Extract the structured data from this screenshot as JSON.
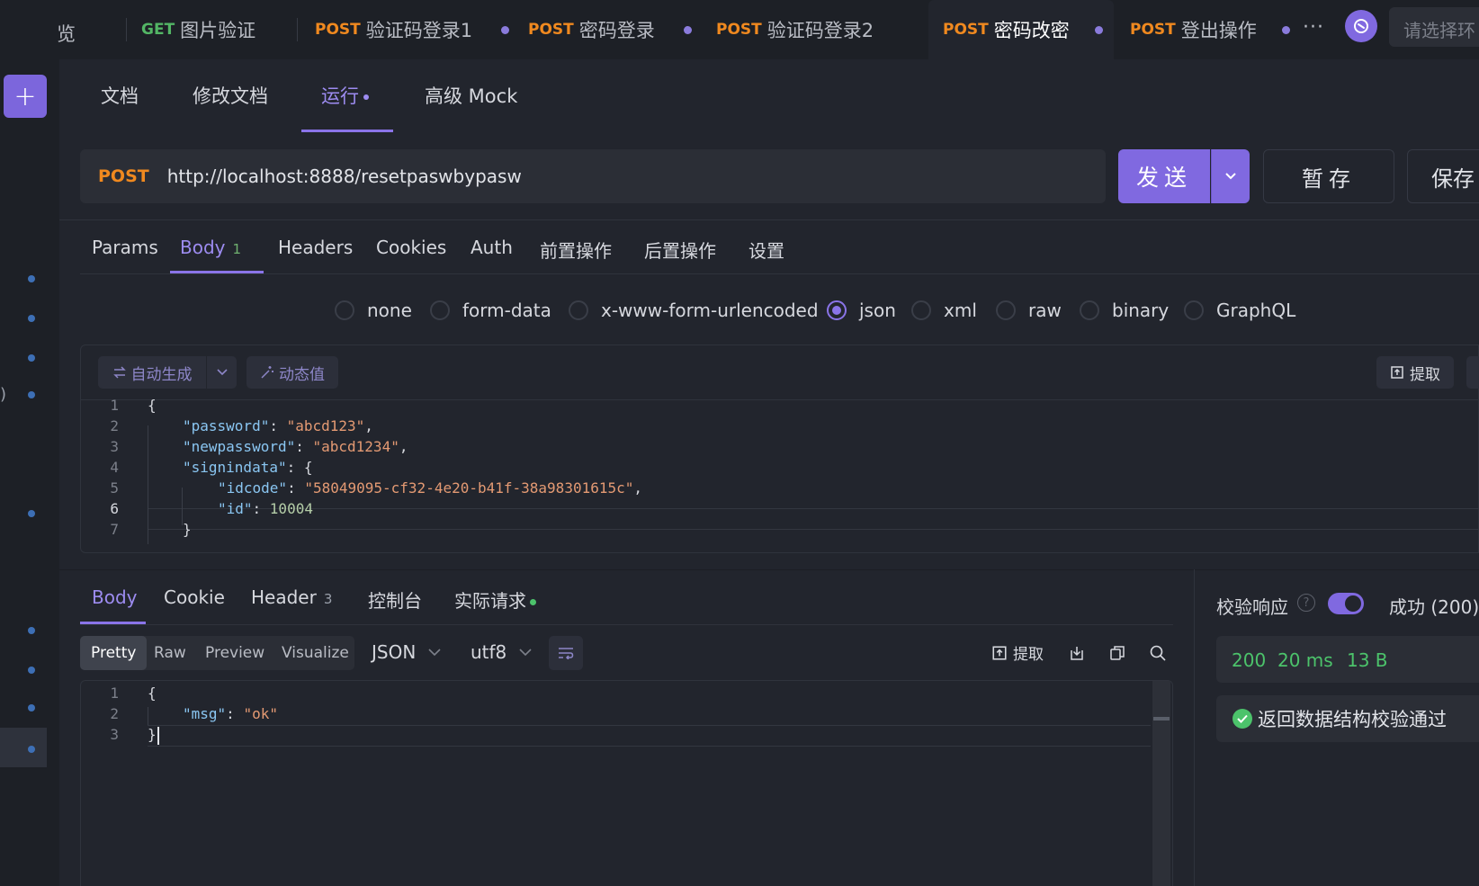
{
  "tabs": [
    {
      "label": "览"
    },
    {
      "method": "GET",
      "label": "图片验证",
      "dirty": false
    },
    {
      "method": "POST",
      "label": "验证码登录1",
      "dirty": true
    },
    {
      "method": "POST",
      "label": "密码登录",
      "dirty": true
    },
    {
      "method": "POST",
      "label": "验证码登录2",
      "dirty": false
    },
    {
      "method": "POST",
      "label": "密码改密",
      "dirty": true,
      "active": true
    },
    {
      "method": "POST",
      "label": "登出操作",
      "dirty": true
    }
  ],
  "topbar": {
    "more": "···",
    "env_placeholder": "请选择环"
  },
  "sidebar": {
    "add": "+",
    "paren": ")"
  },
  "doc_tabs": [
    "文档",
    "修改文档",
    "运行",
    "高级 Mock"
  ],
  "request": {
    "method": "POST",
    "url": "http://localhost:8888/resetpaswbypasw",
    "send": "发送",
    "temp_save": "暂存",
    "save": "保存"
  },
  "req_tabs": {
    "params": "Params",
    "body": "Body",
    "body_count": "1",
    "headers": "Headers",
    "cookies": "Cookies",
    "auth": "Auth",
    "pre": "前置操作",
    "post": "后置操作",
    "settings": "设置"
  },
  "body_types": [
    "none",
    "form-data",
    "x-www-form-urlencoded",
    "json",
    "xml",
    "raw",
    "binary",
    "GraphQL"
  ],
  "body_type_selected": "json",
  "editor_toolbar": {
    "auto_gen": "自动生成",
    "dynamic": "动态值",
    "extract": "提取"
  },
  "body_code": {
    "l1": "{",
    "password_key": "\"password\"",
    "password_val": "\"abcd123\"",
    "newpassword_key": "\"newpassword\"",
    "newpassword_val": "\"abcd1234\"",
    "signindata_key": "\"signindata\"",
    "idcode_key": "\"idcode\"",
    "idcode_val": "\"58049095-cf32-4e20-b41f-38a98301615c\"",
    "id_key": "\"id\"",
    "id_val": "10004",
    "close": "}"
  },
  "resp_tabs": {
    "body": "Body",
    "cookie": "Cookie",
    "header": "Header",
    "header_count": "3",
    "console": "控制台",
    "actual": "实际请求"
  },
  "resp_view": {
    "pretty": "Pretty",
    "raw": "Raw",
    "preview": "Preview",
    "visualize": "Visualize",
    "format": "JSON",
    "encoding": "utf8",
    "extract": "提取"
  },
  "resp_code": {
    "open": "{",
    "msg_key": "\"msg\"",
    "msg_val": "\"ok\"",
    "close": "}"
  },
  "validation": {
    "label": "校验响应",
    "enabled": true,
    "result_select": "成功 (200)",
    "status": "200",
    "time": "20 ms",
    "size": "13 B",
    "check_message": "返回数据结构校验通过"
  },
  "colors": {
    "accent": "#8069e0",
    "post": "#f0891f",
    "get": "#53b665",
    "success": "#4cc36b"
  }
}
